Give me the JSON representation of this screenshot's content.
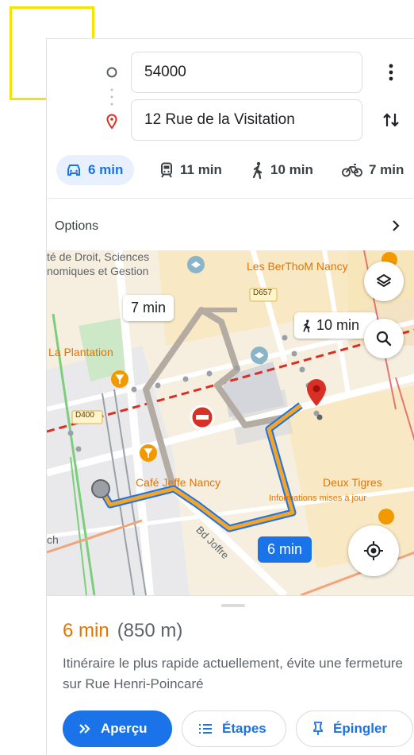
{
  "origin": {
    "value": "54000"
  },
  "destination": {
    "value": "12 Rue de la Visitation"
  },
  "modes": [
    {
      "name": "driving",
      "label": "6 min",
      "icon": "car-icon",
      "active": true
    },
    {
      "name": "transit",
      "label": "11 min",
      "icon": "train-icon",
      "active": false
    },
    {
      "name": "walking",
      "label": "10 min",
      "icon": "walk-icon",
      "active": false
    },
    {
      "name": "cycling",
      "label": "7 min",
      "icon": "bike-icon",
      "active": false
    }
  ],
  "options": {
    "label": "Options"
  },
  "map": {
    "labels": {
      "faculty_line1": "té de Droit, Sciences",
      "faculty_line2": "nomiques et Gestion",
      "berthom": "Les BerThoM Nancy",
      "road_d657": "D657",
      "plantation": "La Plantation",
      "road_d400": "D400",
      "cafe": "Café Jeffe Nancy",
      "deux_tigres": "Deux Tigres",
      "info": "Informations mises à jour",
      "bd_joffre": "Bd Joffre",
      "edge": "ch"
    },
    "alt_route_time": "7 min",
    "walk_time": "10 min",
    "main_route_time": "6 min",
    "colors": {
      "route": "#f3a42b",
      "route_alt": "#b4aca2",
      "primary": "#1a73e8",
      "pin": "#d93025"
    }
  },
  "summary": {
    "time": "6 min",
    "distance": "(850 m)",
    "description": "Itinéraire le plus rapide actuellement, évite une fermeture sur Rue Henri-Poincaré"
  },
  "actions": {
    "overview": "Aperçu",
    "steps": "Étapes",
    "pin": "Épingler"
  }
}
